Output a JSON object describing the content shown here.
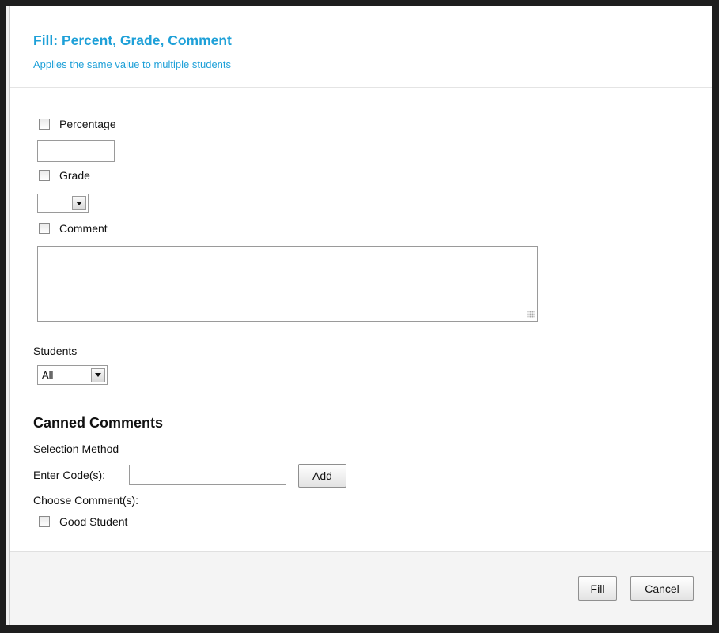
{
  "dialog": {
    "title": "Fill: Percent, Grade, Comment",
    "subtitle": "Applies the same value to multiple students"
  },
  "fields": {
    "percentage_label": "Percentage",
    "percentage_value": "",
    "grade_label": "Grade",
    "grade_value": "",
    "comment_label": "Comment",
    "comment_value": ""
  },
  "students": {
    "label": "Students",
    "selected": "All"
  },
  "canned_comments": {
    "heading": "Canned Comments",
    "selection_method_label": "Selection Method",
    "enter_codes_label": "Enter Code(s):",
    "codes_value": "",
    "add_label": "Add",
    "choose_label": "Choose Comment(s):",
    "options": [
      {
        "label": "Good Student",
        "checked": false
      }
    ]
  },
  "footer": {
    "fill_label": "Fill",
    "cancel_label": "Cancel"
  },
  "colors": {
    "accent": "#1ea0d8",
    "frame": "#1e1e1e"
  }
}
